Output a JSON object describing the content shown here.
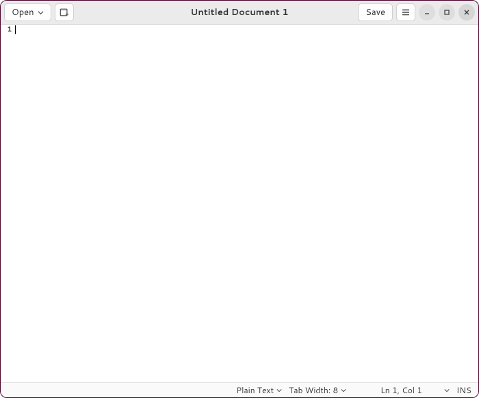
{
  "header": {
    "title": "Untitled Document 1",
    "open_label": "Open",
    "save_label": "Save"
  },
  "editor": {
    "line_number": "1",
    "content": ""
  },
  "status": {
    "language": "Plain Text",
    "tab_width": "Tab Width: 8",
    "position": "Ln 1, Col 1",
    "insert_mode": "INS"
  }
}
